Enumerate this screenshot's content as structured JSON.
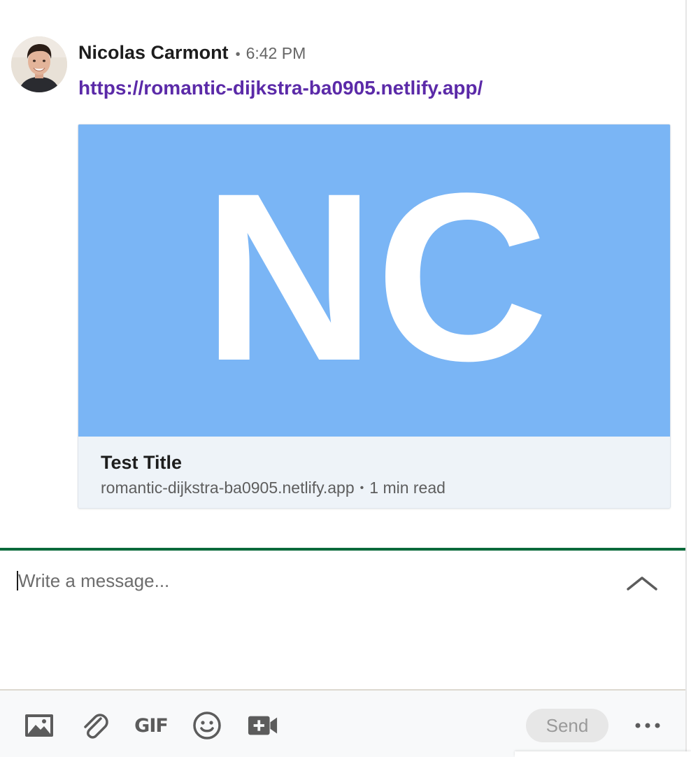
{
  "message": {
    "sender_name": "Nicolas Carmont",
    "separator": "•",
    "timestamp": "6:42 PM",
    "link_text": "https://romantic-dijkstra-ba0905.netlify.app/",
    "avatar_icon": "person-avatar"
  },
  "preview": {
    "image_text": "NC",
    "image_bg_color": "#7ab5f5",
    "title": "Test Title",
    "domain": "romantic-dijkstra-ba0905.netlify.app",
    "separator": "•",
    "read_time": "1 min read"
  },
  "composer": {
    "placeholder": "Write a message...",
    "value": "",
    "accent_color": "#0a6a3b",
    "expand_icon": "chevron-up-icon"
  },
  "toolbar": {
    "image_icon": "image-icon",
    "attach_icon": "paperclip-icon",
    "gif_label": "GIF",
    "emoji_icon": "emoji-icon",
    "video_icon": "video-add-icon",
    "send_label": "Send",
    "more_icon": "more-horizontal-icon"
  }
}
